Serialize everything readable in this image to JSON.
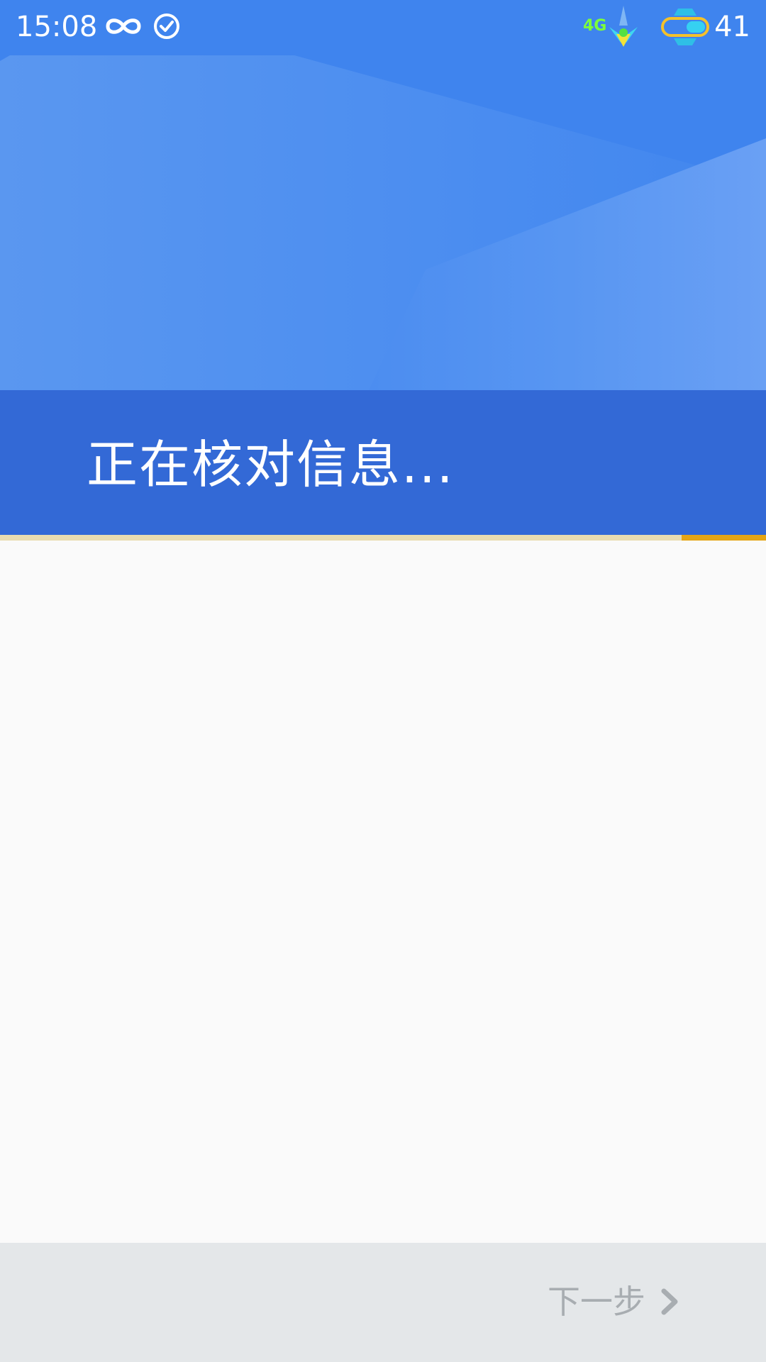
{
  "status_bar": {
    "time": "15:08",
    "icons": [
      "infinity-icon",
      "check-circle-icon"
    ],
    "network_type": "4G",
    "battery_level": "41"
  },
  "header": {
    "title": "正在核对信息..."
  },
  "progress": {
    "fraction": 0.11
  },
  "footer": {
    "next_label": "下一步"
  },
  "colors": {
    "hero_blue": "#4186ee",
    "title_band": "#3369d6",
    "progress_accent": "#e6a514",
    "footer_bg": "#e4e7e9",
    "footer_text": "#a8adb1"
  }
}
